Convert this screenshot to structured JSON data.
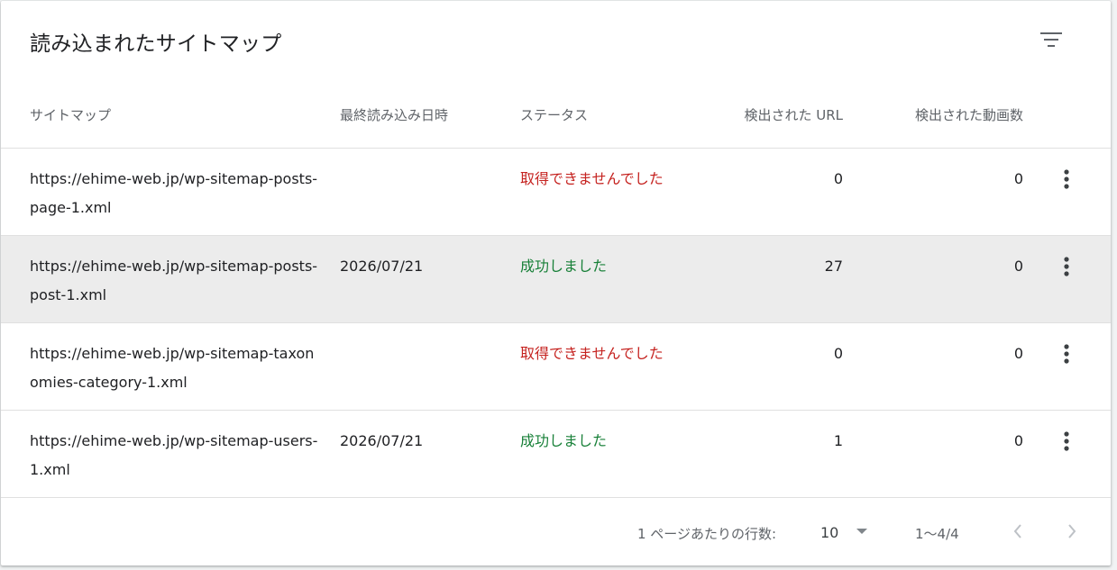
{
  "title": "読み込まれたサイトマップ",
  "columns": {
    "sitemap": "サイトマップ",
    "last_read": "最終読み込み日時",
    "status": "ステータス",
    "discovered_urls": "検出された URL",
    "discovered_videos": "検出された動画数"
  },
  "rows": [
    {
      "url": "https://ehime-web.jp/wp-sitemap-posts-page-1.xml",
      "last_read": "",
      "status": "取得できませんでした",
      "status_type": "error",
      "urls": "0",
      "videos": "0"
    },
    {
      "url": "https://ehime-web.jp/wp-sitemap-posts-post-1.xml",
      "last_read": "2026/07/21",
      "status": "成功しました",
      "status_type": "ok",
      "urls": "27",
      "videos": "0"
    },
    {
      "url": "https://ehime-web.jp/wp-sitemap-taxonomies-category-1.xml",
      "last_read": "",
      "status": "取得できませんでした",
      "status_type": "error",
      "urls": "0",
      "videos": "0"
    },
    {
      "url": "https://ehime-web.jp/wp-sitemap-users-1.xml",
      "last_read": "2026/07/21",
      "status": "成功しました",
      "status_type": "ok",
      "urls": "1",
      "videos": "0"
    }
  ],
  "footer": {
    "rows_per_page_label": "1 ページあたりの行数:",
    "rows_per_page": "10",
    "range": "1〜4/4"
  },
  "colors": {
    "error": "#c5221f",
    "success": "#188038",
    "highlight_row": "#ececec"
  },
  "icons": {
    "filter": "filter-icon",
    "more": "more-vert-icon",
    "dropdown": "dropdown-arrow-icon",
    "prev": "chevron-left-icon",
    "next": "chevron-right-icon"
  }
}
